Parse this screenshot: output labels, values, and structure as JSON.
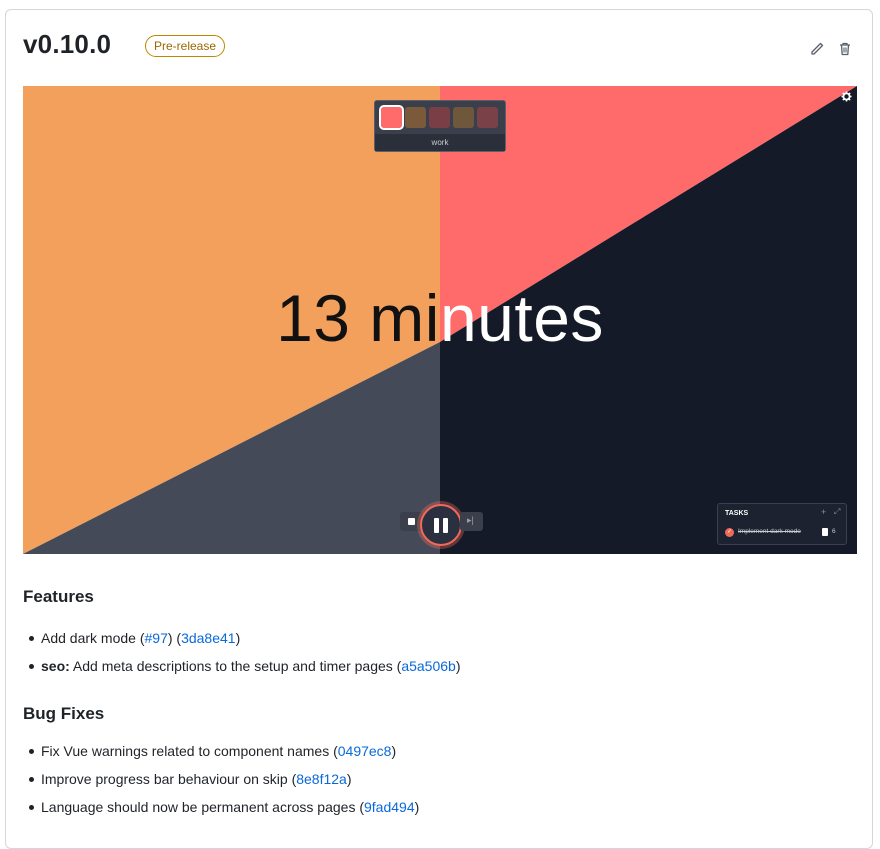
{
  "release": {
    "title": "v0.10.0",
    "badge": "Pre-release"
  },
  "app": {
    "palette_label": "work",
    "swatch_colors": [
      "#ff6b6b",
      "#7a5a3a",
      "#7a3e47",
      "#6e573a",
      "#7a4248"
    ],
    "timer_text": "13 minutes",
    "colors": {
      "orange": "#f2a05c",
      "coral": "#ff6b6b",
      "navy": "#151a28",
      "slate": "#454a58"
    },
    "tasks": {
      "title": "TASKS",
      "item_text": "Implement dark mode",
      "item_count": "6"
    }
  },
  "notes": {
    "features_heading": "Features",
    "features": [
      {
        "pre": "",
        "scope": "",
        "text": "Add dark mode (",
        "link1": "#97",
        "mid": ") (",
        "link2": "3da8e41",
        "post": ")"
      },
      {
        "pre": "",
        "scope": "seo:",
        "text": " Add meta descriptions to the setup and timer pages (",
        "link1": "a5a506b",
        "post": ")"
      }
    ],
    "bugfix_heading": "Bug Fixes",
    "bugfixes": [
      {
        "text": "Fix Vue warnings related to component names (",
        "link": "0497ec8",
        "post": ")"
      },
      {
        "text": "Improve progress bar behaviour on skip (",
        "link": "8e8f12a",
        "post": ")"
      },
      {
        "text": "Language should now be permanent across pages (",
        "link": "9fad494",
        "post": ")"
      }
    ]
  }
}
